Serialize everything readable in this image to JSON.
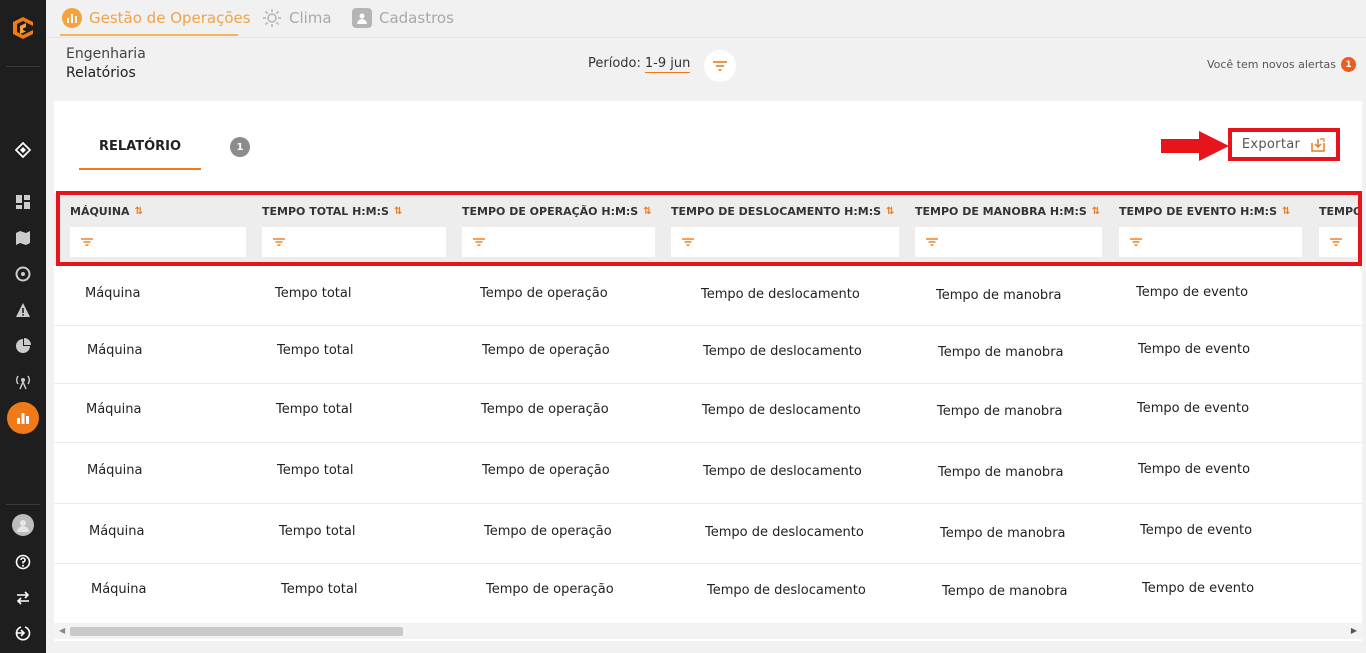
{
  "nav_tabs": [
    {
      "label": "Gestão de Operações",
      "icon": "chart-icon",
      "active": true
    },
    {
      "label": "Clima",
      "icon": "sun-icon",
      "active": false
    },
    {
      "label": "Cadastros",
      "icon": "user-icon",
      "active": false
    }
  ],
  "breadcrumb": {
    "section": "Engenharia",
    "page": "Relatórios"
  },
  "period": {
    "label": "Período:",
    "value": "1-9 jun"
  },
  "alerts": {
    "text": "Você tem novos alertas",
    "count": "1"
  },
  "report_tab": {
    "label": "RELATÓRIO",
    "count": "1"
  },
  "export": {
    "label": "Exportar"
  },
  "columns": [
    "MÁQUINA",
    "TEMPO TOTAL H:M:S",
    "TEMPO DE OPERAÇÃO H:M:S",
    "TEMPO DE DESLOCAMENTO H:M:S",
    "TEMPO DE MANOBRA H:M:S",
    "TEMPO DE EVENTO H:M:S",
    "TEMPO"
  ],
  "rows": [
    [
      "Máquina",
      "Tempo total",
      "Tempo de operação",
      "Tempo de deslocamento",
      "Tempo de manobra",
      "Tempo de evento"
    ],
    [
      "Máquina",
      "Tempo total",
      "Tempo de operação",
      "Tempo de deslocamento",
      "Tempo de manobra",
      "Tempo de evento"
    ],
    [
      "Máquina",
      "Tempo total",
      "Tempo de operação",
      "Tempo de deslocamento",
      "Tempo de manobra",
      "Tempo de evento"
    ],
    [
      "Máquina",
      "Tempo total",
      "Tempo de operação",
      "Tempo de deslocamento",
      "Tempo de manobra",
      "Tempo de evento"
    ],
    [
      "Máquina",
      "Tempo total",
      "Tempo de operação",
      "Tempo de deslocamento",
      "Tempo de manobra",
      "Tempo de evento"
    ],
    [
      "Máquina",
      "Tempo total",
      "Tempo de operação",
      "Tempo de deslocamento",
      "Tempo de manobra",
      "Tempo de evento"
    ]
  ],
  "sidebar_icons": [
    "logo-icon",
    "diamond-icon",
    "dashboard-icon",
    "map-icon",
    "gauge-icon",
    "warning-icon",
    "pie-icon",
    "antenna-icon",
    "reports-icon",
    "avatar",
    "help-icon",
    "swap-icon",
    "logout-icon"
  ],
  "colors": {
    "accent": "#f07a1a",
    "highlight": "#e8141b",
    "sidebar": "#1e1e1e"
  }
}
